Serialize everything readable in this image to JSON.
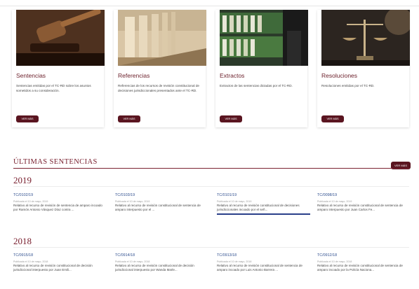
{
  "cards": [
    {
      "title": "Sentencias",
      "desc": "Sentencias emitidas por el TC-RD sobre los asuntos sometidos a su consideración.",
      "button": "VER MÁS",
      "image": "gavel-photo"
    },
    {
      "title": "Referencias",
      "desc": "Referencias de los recursos de revisión constitucional de decisiones jurisdiccionales presentados ante el TC-RD.",
      "button": "VER MÁS",
      "image": "columns-photo"
    },
    {
      "title": "Extractos",
      "desc": "Extractos de las sentencias dictadas por el TC-RD.",
      "button": "VER MÁS",
      "image": "binders-photo"
    },
    {
      "title": "Resoluciones",
      "desc": "Resoluciones emitidas por el TC-RD.",
      "button": "VER MÁS",
      "image": "justice-scale-photo"
    }
  ],
  "latest": {
    "title": "ÚLTIMAS SENTENCIAS",
    "button": "VER MÁS",
    "years": [
      {
        "year": "2019",
        "items": [
          {
            "id": "TC/0102/19",
            "meta": "Publicada el 10 de mayo, 2019",
            "text": "Relativo al recurso de revisión de sentencia de amparo incoado por Ramón Antonio Vásquez Díaz contra ..."
          },
          {
            "id": "TC/0103/19",
            "meta": "Publicada el 10 de mayo, 2019",
            "text": "Relativo al recurso de revisión constitucional de sentencia de amparo interpuesto por el ..."
          },
          {
            "id": "TC/0101/19",
            "meta": "Publicada el 10 de mayo, 2019",
            "text": "Relativo al recurso de revisión constitucional de decisiones jurisdiccionales incoado por el señ...",
            "highlight": true
          },
          {
            "id": "TC/0098/19",
            "meta": "Publicada el 10 de mayo, 2019",
            "text": "Relativo al recurso de revisión constitucional de sentencia de amparo interpuesto por Juan Carlos Fe..."
          }
        ]
      },
      {
        "year": "2018",
        "items": [
          {
            "id": "TC/0915/18",
            "meta": "Publicada el 10 de mayo, 2018",
            "text": "Relativo al recurso de revisión constitucional de decisión jurisdiccional interpuesto por Juan Emili..."
          },
          {
            "id": "TC/0914/18",
            "meta": "Publicada el 10 de mayo, 2018",
            "text": "Relativo al recurso de revisión constitucional de decisión jurisdiccional interpuesto por Wanda Marle..."
          },
          {
            "id": "TC/0913/18",
            "meta": "Publicada el 10 de mayo, 2018",
            "text": "Relativo al recurso de revisión constitucional de sentencia de amparo incoado por Luis Antonio Barrera ..."
          },
          {
            "id": "TC/0912/18",
            "meta": "Publicada el 10 de mayo, 2018",
            "text": "Relativo al recurso de revisión constitucional de sentencia de amparo incoado por la Policía Naciona..."
          }
        ]
      }
    ]
  },
  "colors": {
    "accent": "#5a1520",
    "title": "#7a2130",
    "link": "#2f4f8f"
  }
}
